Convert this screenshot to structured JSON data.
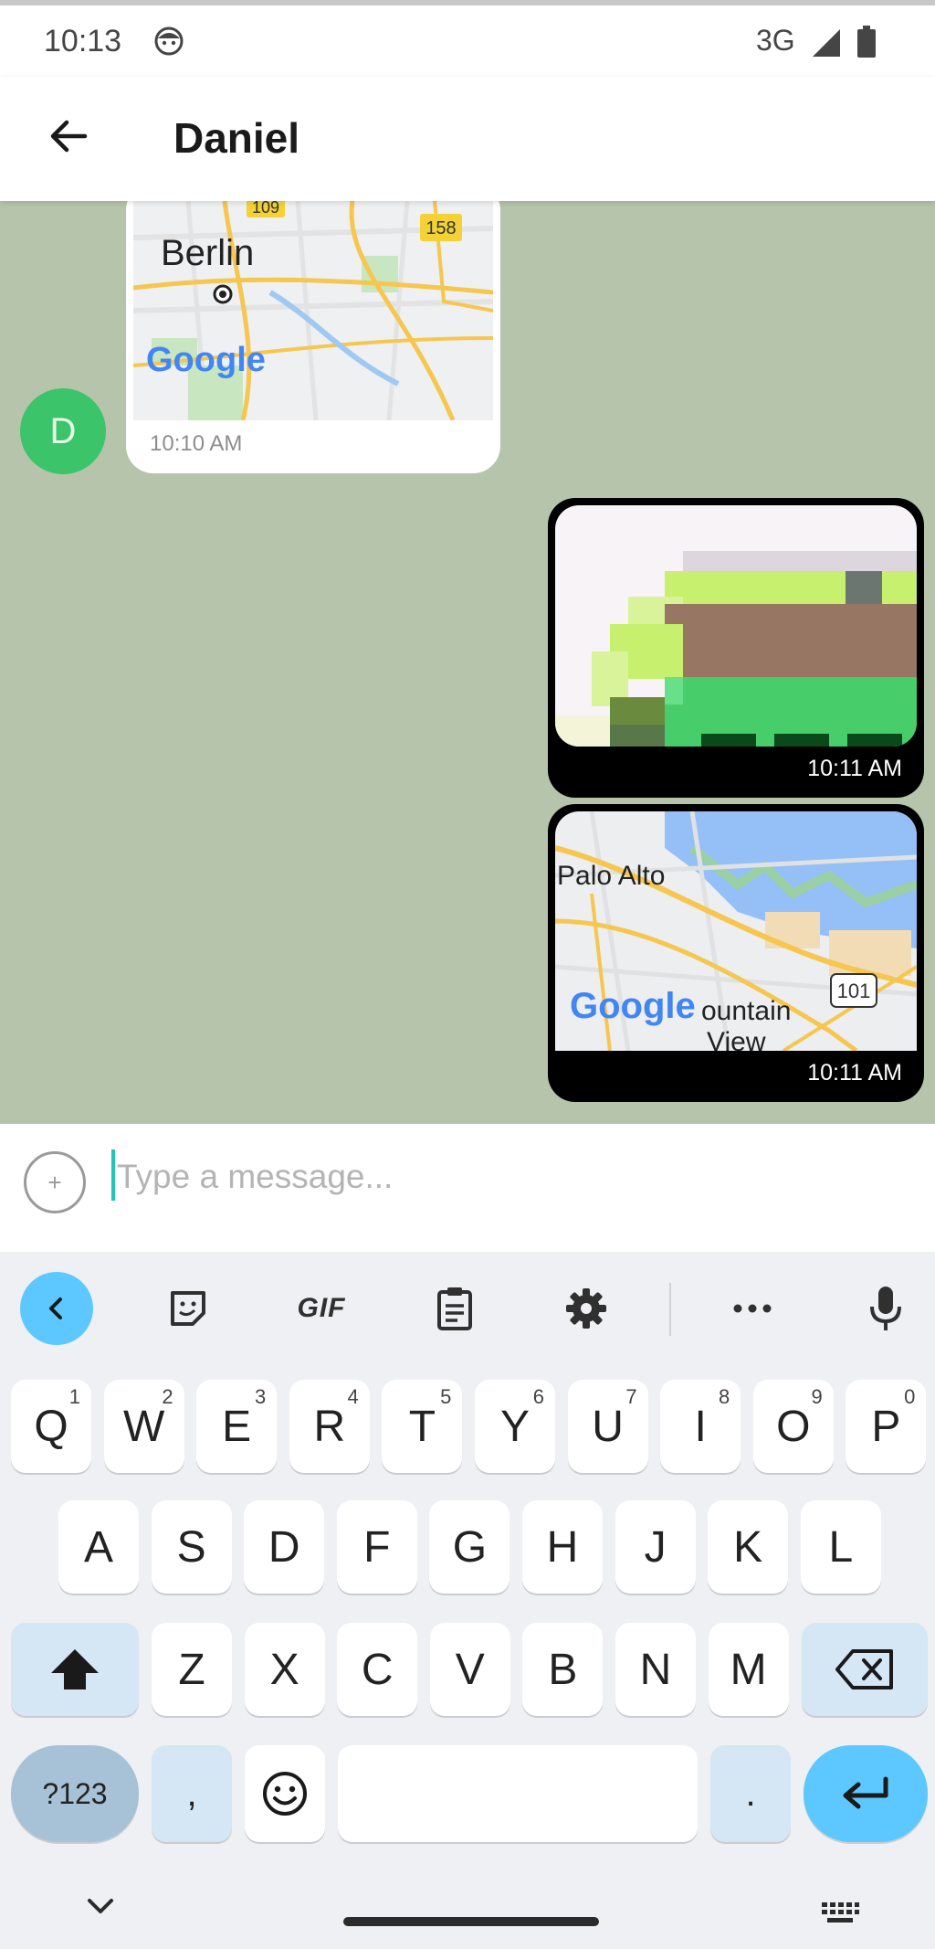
{
  "status_bar": {
    "time": "10:13",
    "network": "3G",
    "icons": [
      "face-notification-icon",
      "signal-icon",
      "battery-icon"
    ]
  },
  "header": {
    "title": "Daniel",
    "back_icon": "back-arrow-icon"
  },
  "messages": [
    {
      "direction": "incoming",
      "sender_initial": "D",
      "type": "map",
      "map_labels": {
        "city": "Berlin",
        "route_a": "109",
        "route_b": "158",
        "logo": "Google"
      },
      "time": "10:10 AM"
    },
    {
      "direction": "outgoing",
      "type": "image",
      "time": "10:11 AM"
    },
    {
      "direction": "outgoing",
      "type": "map",
      "map_labels": {
        "city_a": "Palo Alto",
        "city_b_line1": "ountain",
        "city_b_line2": "View",
        "route": "101",
        "logo": "Google"
      },
      "time": "10:11 AM"
    }
  ],
  "input": {
    "placeholder": "Type a message...",
    "attach_icon": "add-attachment-icon"
  },
  "keyboard": {
    "toolbar": {
      "gif_label": "GIF",
      "icons": [
        "collapse-icon",
        "sticker-icon",
        "clipboard-icon",
        "settings-icon",
        "more-icon",
        "mic-icon"
      ]
    },
    "row1": [
      {
        "key": "Q",
        "hint": "1"
      },
      {
        "key": "W",
        "hint": "2"
      },
      {
        "key": "E",
        "hint": "3"
      },
      {
        "key": "R",
        "hint": "4"
      },
      {
        "key": "T",
        "hint": "5"
      },
      {
        "key": "Y",
        "hint": "6"
      },
      {
        "key": "U",
        "hint": "7"
      },
      {
        "key": "I",
        "hint": "8"
      },
      {
        "key": "O",
        "hint": "9"
      },
      {
        "key": "P",
        "hint": "0"
      }
    ],
    "row2": [
      "A",
      "S",
      "D",
      "F",
      "G",
      "H",
      "J",
      "K",
      "L"
    ],
    "row3": [
      "Z",
      "X",
      "C",
      "V",
      "B",
      "N",
      "M"
    ],
    "row4": {
      "symbols": "?123",
      "comma": ",",
      "period": "."
    }
  },
  "colors": {
    "chat_background": "#b5c4aa",
    "avatar": "#3bc469",
    "outgoing_bubble": "#000000",
    "accent": "#5cc8ff",
    "cursor": "#1fc6b2"
  }
}
